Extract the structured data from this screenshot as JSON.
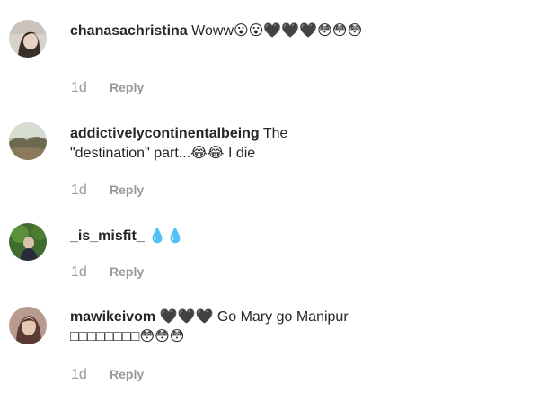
{
  "comments": [
    {
      "username": "chanasachristina",
      "text": " Woww😮😮🖤🖤🖤😳😳😳",
      "time": "1d",
      "reply_label": "Reply"
    },
    {
      "username": "addictivelycontinentalbeing",
      "text": " The \"destination\" part...😂😂 I die",
      "time": "1d",
      "reply_label": "Reply"
    },
    {
      "username": "_is_misfit_",
      "text": " 💧💧",
      "time": "1d",
      "reply_label": "Reply"
    },
    {
      "username": "mawikeivom",
      "text": " 🖤🖤🖤 Go Mary go Manipur □□□□□□□□😳😳😳",
      "time": "1d",
      "reply_label": "Reply"
    }
  ]
}
